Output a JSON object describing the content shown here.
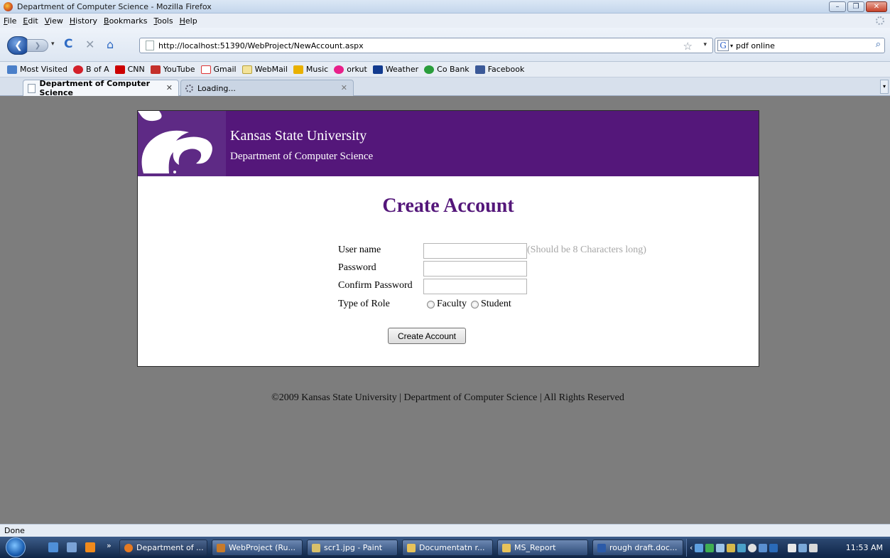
{
  "window": {
    "title": "Department of Computer Science - Mozilla Firefox"
  },
  "menu": [
    "File",
    "Edit",
    "View",
    "History",
    "Bookmarks",
    "Tools",
    "Help"
  ],
  "nav": {
    "url": "http://localhost:51390/WebProject/NewAccount.aspx",
    "search_value": "pdf online"
  },
  "bookmarks": [
    "Most Visited",
    "B of A",
    "CNN",
    "YouTube",
    "Gmail",
    "WebMail",
    "Music",
    "orkut",
    "Weather",
    "Co Bank",
    "Facebook"
  ],
  "tabs": [
    {
      "label": "Department of Computer Science"
    },
    {
      "label": "Loading..."
    }
  ],
  "page": {
    "university": "Kansas State University",
    "department": "Department of Computer Science",
    "heading": "Create Account",
    "form": {
      "username_label": "User name",
      "username_value": "",
      "username_hint": "(Should be 8 Characters long)",
      "password_label": "Password",
      "confirm_label": "Confirm Password",
      "role_label": "Type of Role",
      "role_options": [
        "Faculty",
        "Student"
      ],
      "submit_label": "Create Account"
    },
    "footer": "©2009 Kansas State University | Department of Computer Science | All Rights Reserved"
  },
  "status": "Done",
  "taskbar": {
    "items": [
      "Department of ...",
      "WebProject (Ru...",
      "scr1.jpg - Paint",
      "Documentatn r...",
      "MS_Report",
      "rough draft.doc..."
    ],
    "clock": "11:53 AM"
  },
  "colors": {
    "brand_purple": "#54177a",
    "page_gray": "#7d7d7d"
  }
}
